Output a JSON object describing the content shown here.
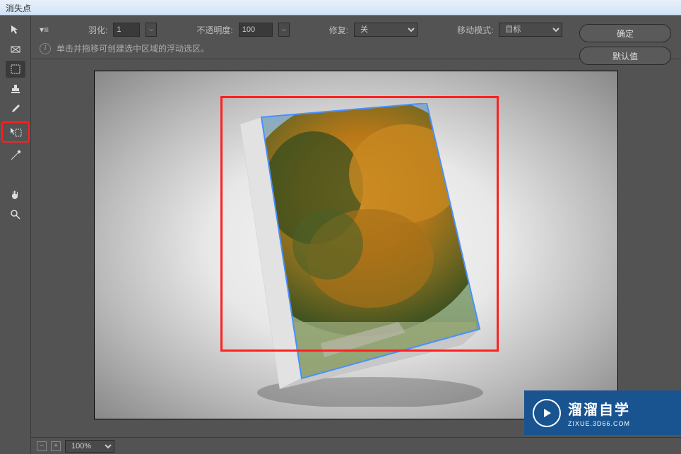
{
  "window": {
    "title": "消失点"
  },
  "options": {
    "feather_label": "羽化:",
    "feather_value": "1",
    "opacity_label": "不透明度:",
    "opacity_value": "100",
    "heal_label": "修复:",
    "heal_value": "关",
    "move_label": "移动模式:",
    "move_value": "目标"
  },
  "info": {
    "hint": "单击并拖移可创建选中区域的浮动选区。"
  },
  "buttons": {
    "ok": "确定",
    "default": "默认值"
  },
  "zoom": {
    "value": "100%"
  },
  "watermark": {
    "main": "溜溜自学",
    "sub": "ZIXUE.3D66.COM"
  },
  "tools": {
    "t1": "edit-plane",
    "t2": "create-plane",
    "t3": "marquee",
    "t4": "stamp",
    "t5": "brush",
    "t6": "transform",
    "t7": "eyedropper",
    "t8": "measure",
    "t9": "hand",
    "t10": "zoom"
  }
}
